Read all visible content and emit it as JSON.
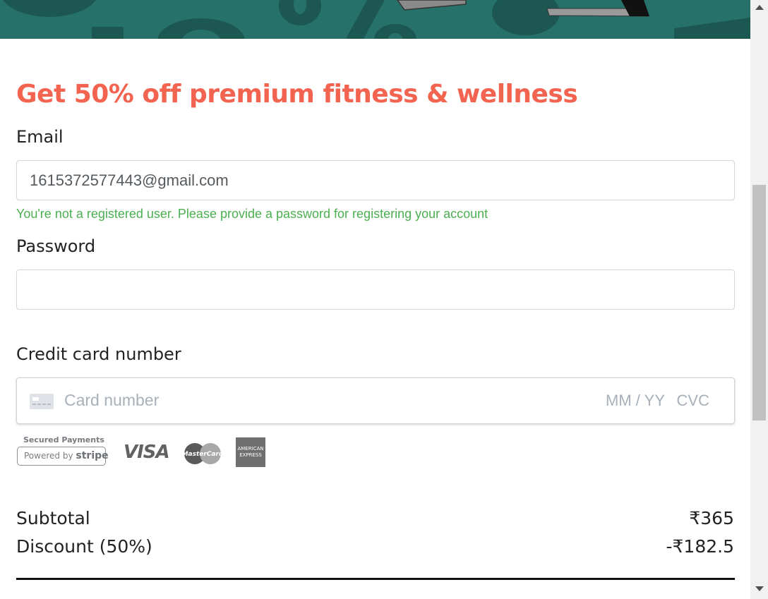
{
  "colors": {
    "accent": "#f26350",
    "banner": "#27716b",
    "success": "#4caf50",
    "text": "#222222",
    "placeholder": "#a8b0ba"
  },
  "headline": "Get 50% off premium fitness & wellness",
  "email": {
    "label": "Email",
    "value": "1615372577443@gmail.com",
    "helper": "You're not a registered user. Please provide a password for registering your account"
  },
  "password": {
    "label": "Password",
    "value": ""
  },
  "credit_card": {
    "label": "Credit card number",
    "number_placeholder": "Card number",
    "expiry_placeholder": "MM / YY",
    "cvc_placeholder": "CVC",
    "icon": "credit-card-icon"
  },
  "badges": {
    "secured_caption": "Secured Payments",
    "powered_by": "Powered by",
    "stripe": "stripe",
    "visa": "VISA",
    "mastercard": "MasterCard",
    "amex_line1": "AMERICAN",
    "amex_line2": "EXPRESS"
  },
  "summary": {
    "subtotal_label": "Subtotal",
    "subtotal_value": "₹365",
    "discount_label": "Discount (50%)",
    "discount_value": "-₹182.5"
  }
}
